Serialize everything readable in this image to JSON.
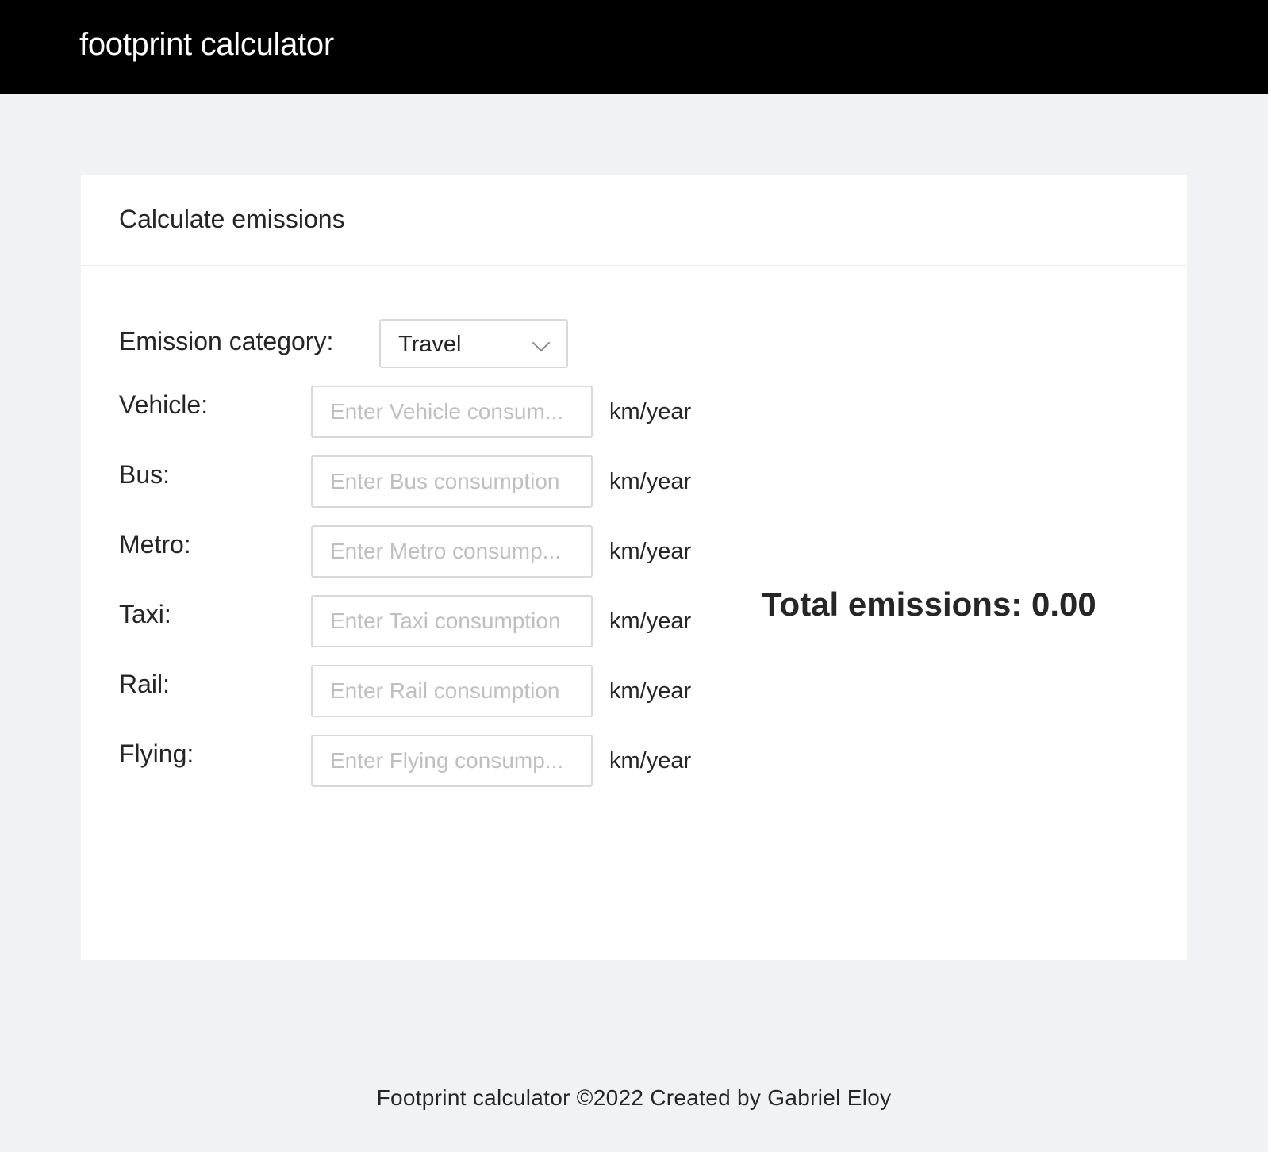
{
  "header": {
    "title": "footprint calculator"
  },
  "card": {
    "title": "Calculate emissions",
    "category": {
      "label": "Emission category:",
      "selected": "Travel"
    },
    "rows": [
      {
        "label": "Vehicle:",
        "placeholder": "Enter Vehicle consum...",
        "value": "",
        "unit": "km/year"
      },
      {
        "label": "Bus:",
        "placeholder": "Enter Bus consumption",
        "value": "",
        "unit": "km/year"
      },
      {
        "label": "Metro:",
        "placeholder": "Enter Metro consump...",
        "value": "",
        "unit": "km/year"
      },
      {
        "label": "Taxi:",
        "placeholder": "Enter Taxi consumption",
        "value": "",
        "unit": "km/year"
      },
      {
        "label": "Rail:",
        "placeholder": "Enter Rail consumption",
        "value": "",
        "unit": "km/year"
      },
      {
        "label": "Flying:",
        "placeholder": "Enter Flying consump...",
        "value": "",
        "unit": "km/year"
      }
    ],
    "total": "Total emissions: 0.00"
  },
  "footer": {
    "text": "Footprint calculator ©2022 Created by Gabriel Eloy"
  },
  "colors": {
    "header_bg": "#000000",
    "page_bg": "#f0f2f5",
    "card_bg": "#ffffff",
    "input_border": "#d9d9d9",
    "placeholder": "#bfbfbf"
  },
  "icons": {
    "select_arrow": "chevron-down-icon"
  }
}
